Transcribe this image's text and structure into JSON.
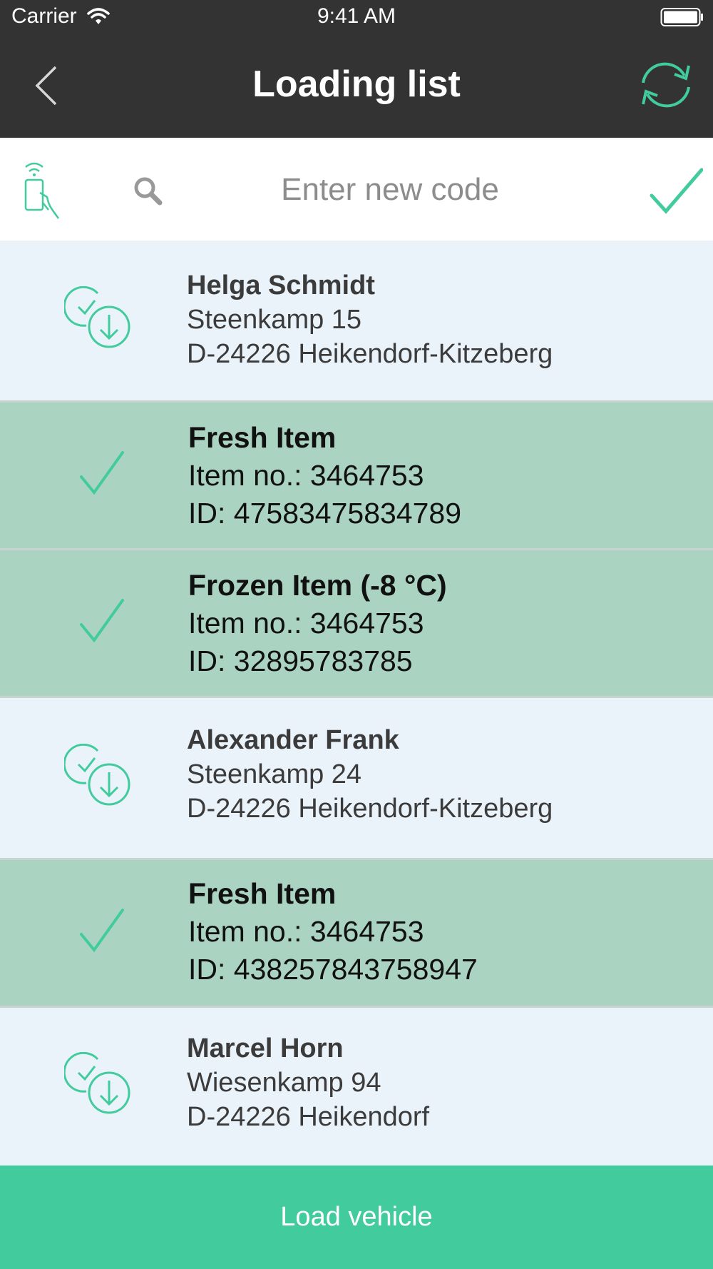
{
  "status_bar": {
    "carrier": "Carrier",
    "time": "9:41 AM"
  },
  "nav": {
    "title": "Loading list",
    "back_icon": "chevron-left-icon",
    "sync_icon": "sync-icon"
  },
  "search": {
    "placeholder": "Enter new code",
    "value": "",
    "nfc_icon": "nfc-scan-icon",
    "search_icon": "search-icon",
    "confirm_icon": "checkmark-icon"
  },
  "colors": {
    "accent": "#42cb9d",
    "header": "#333333",
    "customer_row": "#eaf2fa",
    "item_row": "#aad4c1"
  },
  "list": [
    {
      "type": "customer",
      "icon": "check-download-icon",
      "name": "Helga Schmidt",
      "line1": "Steenkamp 15",
      "line2": "D-24226 Heikendorf-Kitzeberg"
    },
    {
      "type": "item",
      "icon": "checkmark-icon",
      "name": "Fresh Item",
      "line1": "Item no.: 3464753",
      "line2": "ID: 47583475834789"
    },
    {
      "type": "item",
      "icon": "checkmark-icon",
      "name": "Frozen Item (-8 °C)",
      "line1": "Item no.: 3464753",
      "line2": "ID: 32895783785"
    },
    {
      "type": "customer",
      "icon": "check-download-icon",
      "name": "Alexander Frank",
      "line1": "Steenkamp 24",
      "line2": "D-24226 Heikendorf-Kitzeberg"
    },
    {
      "type": "item",
      "icon": "checkmark-icon",
      "name": "Fresh Item",
      "line1": "Item no.: 3464753",
      "line2": "ID: 438257843758947"
    },
    {
      "type": "customer",
      "icon": "check-download-icon",
      "name": "Marcel Horn",
      "line1": "Wiesenkamp 94",
      "line2": "D-24226 Heikendorf"
    }
  ],
  "footer": {
    "button_label": "Load vehicle"
  }
}
